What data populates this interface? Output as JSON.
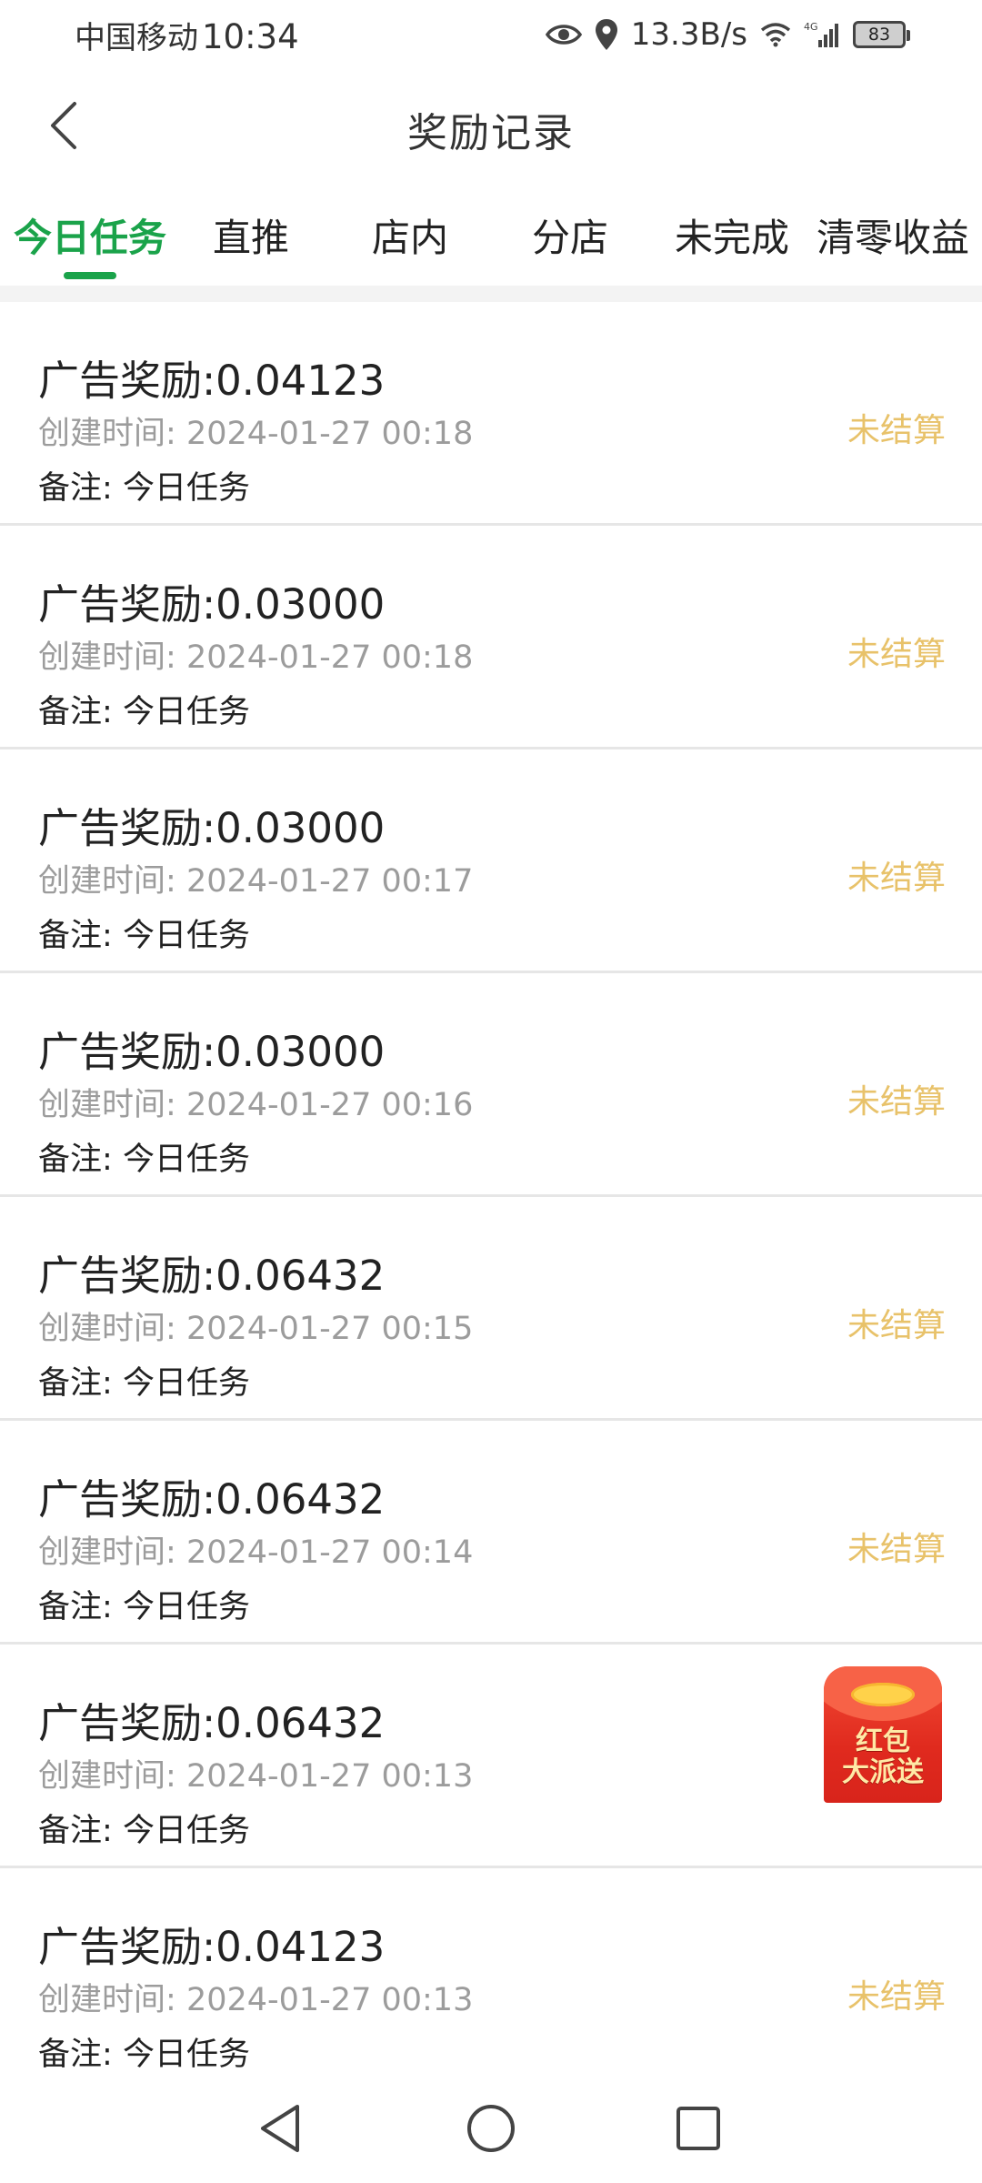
{
  "status_bar": {
    "carrier": "中国移动",
    "time": "10:34",
    "network_speed": "13.3B/s",
    "network_type": "4G",
    "battery": "83"
  },
  "header": {
    "title": "奖励记录"
  },
  "tabs": [
    {
      "label": "今日任务",
      "active": true
    },
    {
      "label": "直推",
      "active": false
    },
    {
      "label": "店内",
      "active": false
    },
    {
      "label": "分店",
      "active": false
    },
    {
      "label": "未完成",
      "active": false
    },
    {
      "label": "清零收益",
      "active": false
    }
  ],
  "records": [
    {
      "label": "广告奖励:",
      "amount": "0.04123",
      "time_label": "创建时间:",
      "time": "2024-01-27 00:18",
      "note_label": "备注:",
      "note": "今日任务",
      "status": "未结算"
    },
    {
      "label": "广告奖励:",
      "amount": "0.03000",
      "time_label": "创建时间:",
      "time": "2024-01-27 00:18",
      "note_label": "备注:",
      "note": "今日任务",
      "status": "未结算"
    },
    {
      "label": "广告奖励:",
      "amount": "0.03000",
      "time_label": "创建时间:",
      "time": "2024-01-27 00:17",
      "note_label": "备注:",
      "note": "今日任务",
      "status": "未结算"
    },
    {
      "label": "广告奖励:",
      "amount": "0.03000",
      "time_label": "创建时间:",
      "time": "2024-01-27 00:16",
      "note_label": "备注:",
      "note": "今日任务",
      "status": "未结算"
    },
    {
      "label": "广告奖励:",
      "amount": "0.06432",
      "time_label": "创建时间:",
      "time": "2024-01-27 00:15",
      "note_label": "备注:",
      "note": "今日任务",
      "status": "未结算"
    },
    {
      "label": "广告奖励:",
      "amount": "0.06432",
      "time_label": "创建时间:",
      "time": "2024-01-27 00:14",
      "note_label": "备注:",
      "note": "今日任务",
      "status": "未结算"
    },
    {
      "label": "广告奖励:",
      "amount": "0.06432",
      "time_label": "创建时间:",
      "time": "2024-01-27 00:13",
      "note_label": "备注:",
      "note": "今日任务",
      "status": ""
    },
    {
      "label": "广告奖励:",
      "amount": "0.04123",
      "time_label": "创建时间:",
      "time": "2024-01-27 00:13",
      "note_label": "备注:",
      "note": "今日任务",
      "status": "未结算"
    }
  ],
  "red_packet": {
    "line1": "红包",
    "line2": "大派送"
  },
  "colors": {
    "accent": "#1aa34a",
    "status_pending": "#e8c26a",
    "muted_text": "#9c9c9c"
  },
  "icons": {
    "back": "chevron-left-icon",
    "nav_back": "triangle-back-icon",
    "nav_home": "circle-home-icon",
    "nav_recents": "square-recents-icon"
  }
}
